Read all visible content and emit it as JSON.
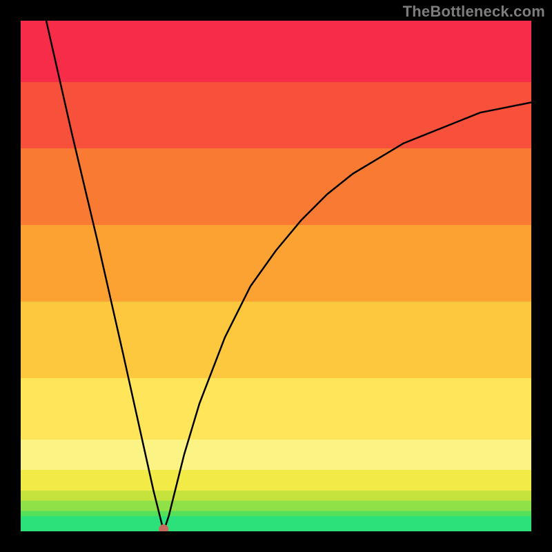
{
  "attribution": "TheBottleneck.com",
  "chart_data": {
    "type": "line",
    "title": "",
    "xlabel": "",
    "ylabel": "",
    "xlim": [
      0,
      100
    ],
    "ylim": [
      0,
      100
    ],
    "optimum_x": 28,
    "curve": [
      {
        "x": 5,
        "y": 100
      },
      {
        "x": 10,
        "y": 78
      },
      {
        "x": 15,
        "y": 57
      },
      {
        "x": 20,
        "y": 35
      },
      {
        "x": 22,
        "y": 26
      },
      {
        "x": 24,
        "y": 17
      },
      {
        "x": 26,
        "y": 8
      },
      {
        "x": 27,
        "y": 4
      },
      {
        "x": 28,
        "y": 0
      },
      {
        "x": 29,
        "y": 3
      },
      {
        "x": 30,
        "y": 7
      },
      {
        "x": 32,
        "y": 15
      },
      {
        "x": 35,
        "y": 25
      },
      {
        "x": 40,
        "y": 38
      },
      {
        "x": 45,
        "y": 48
      },
      {
        "x": 50,
        "y": 55
      },
      {
        "x": 55,
        "y": 61
      },
      {
        "x": 60,
        "y": 66
      },
      {
        "x": 65,
        "y": 70
      },
      {
        "x": 70,
        "y": 73
      },
      {
        "x": 75,
        "y": 76
      },
      {
        "x": 80,
        "y": 78
      },
      {
        "x": 85,
        "y": 80
      },
      {
        "x": 90,
        "y": 82
      },
      {
        "x": 95,
        "y": 83
      },
      {
        "x": 100,
        "y": 84
      }
    ],
    "marker": {
      "x": 28,
      "y": 0
    },
    "gradient_bands": [
      {
        "y0": 0,
        "y1": 3,
        "color": "#2ce07a"
      },
      {
        "y0": 3,
        "y1": 4,
        "color": "#56e05a"
      },
      {
        "y0": 4,
        "y1": 6,
        "color": "#90e148"
      },
      {
        "y0": 6,
        "y1": 8,
        "color": "#c6e23d"
      },
      {
        "y0": 8,
        "y1": 12,
        "color": "#f2ea47"
      },
      {
        "y0": 12,
        "y1": 18,
        "color": "#fbf383"
      },
      {
        "y0": 18,
        "y1": 30,
        "color": "#fee55a"
      },
      {
        "y0": 30,
        "y1": 45,
        "color": "#fdc83e"
      },
      {
        "y0": 45,
        "y1": 60,
        "color": "#fba232"
      },
      {
        "y0": 60,
        "y1": 75,
        "color": "#f97b33"
      },
      {
        "y0": 75,
        "y1": 88,
        "color": "#f8513b"
      },
      {
        "y0": 88,
        "y1": 100,
        "color": "#f62c49"
      }
    ]
  }
}
